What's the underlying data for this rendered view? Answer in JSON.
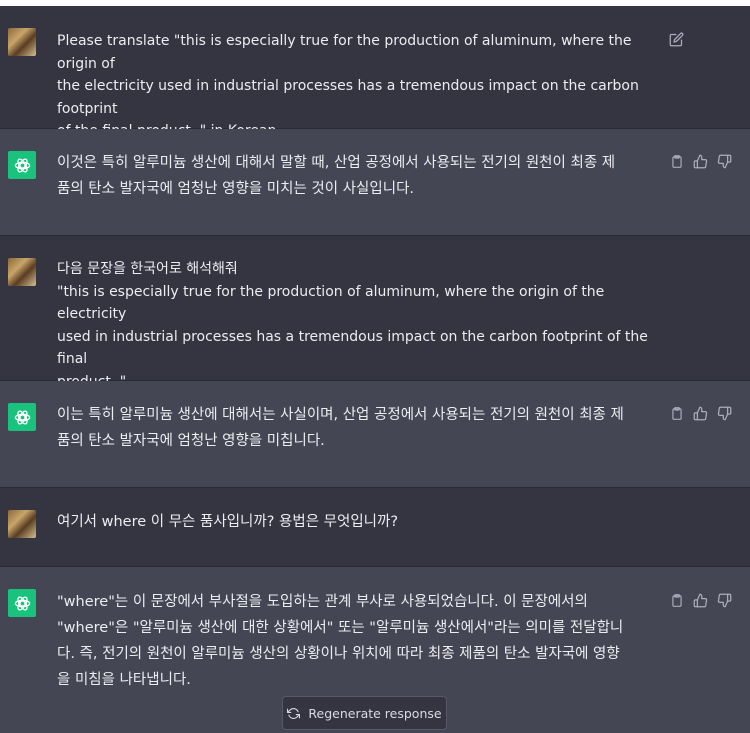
{
  "messages": [
    {
      "role": "user",
      "text": "Please translate \"this is especially true for the production of aluminum, where the origin of\nthe electricity used in industrial processes has a tremendous impact on the carbon footprint\nof the final product. \" in Korean"
    },
    {
      "role": "assistant",
      "text": "이것은 특히 알루미늄 생산에 대해서 말할 때, 산업 공정에서 사용되는 전기의 원천이 최종 제\n품의 탄소 발자국에 엄청난 영향을 미치는 것이 사실입니다."
    },
    {
      "role": "user",
      "text": "다음 문장을 한국어로 해석해줘\n\"this is especially true for the production of aluminum, where the origin of the electricity\nused in industrial processes has a tremendous impact on the carbon footprint of the final\nproduct. \""
    },
    {
      "role": "assistant",
      "text": "이는 특히 알루미늄 생산에 대해서는 사실이며, 산업 공정에서 사용되는 전기의 원천이 최종 제\n품의 탄소 발자국에 엄청난 영향을 미칩니다."
    },
    {
      "role": "user",
      "text": "여기서 where 이 무슨 품사입니까? 용법은 무엇입니까?"
    },
    {
      "role": "assistant",
      "text": "\"where\"는 이 문장에서 부사절을 도입하는 관계 부사로 사용되었습니다. 이 문장에서의\n\"where\"은 \"알루미늄 생산에 대한 상황에서\" 또는 \"알루미늄 생산에서\"라는 의미를 전달합니\n다. 즉, 전기의 원천이 알루미늄 생산의 상황이나 위치에 따라 최종 제품의 탄소 발자국에 영향\n을 미침을 나타냅니다."
    }
  ],
  "regenerate": {
    "label": "Regenerate response",
    "icon": "refresh-icon"
  },
  "icons": {
    "edit": "edit-icon",
    "copy": "clipboard-icon",
    "like": "thumbs-up-icon",
    "dislike": "thumbs-down-icon"
  },
  "colors": {
    "user_bg": "#343541",
    "assistant_bg": "#444654",
    "brand": "#19c37d",
    "text": "#ececf1"
  }
}
